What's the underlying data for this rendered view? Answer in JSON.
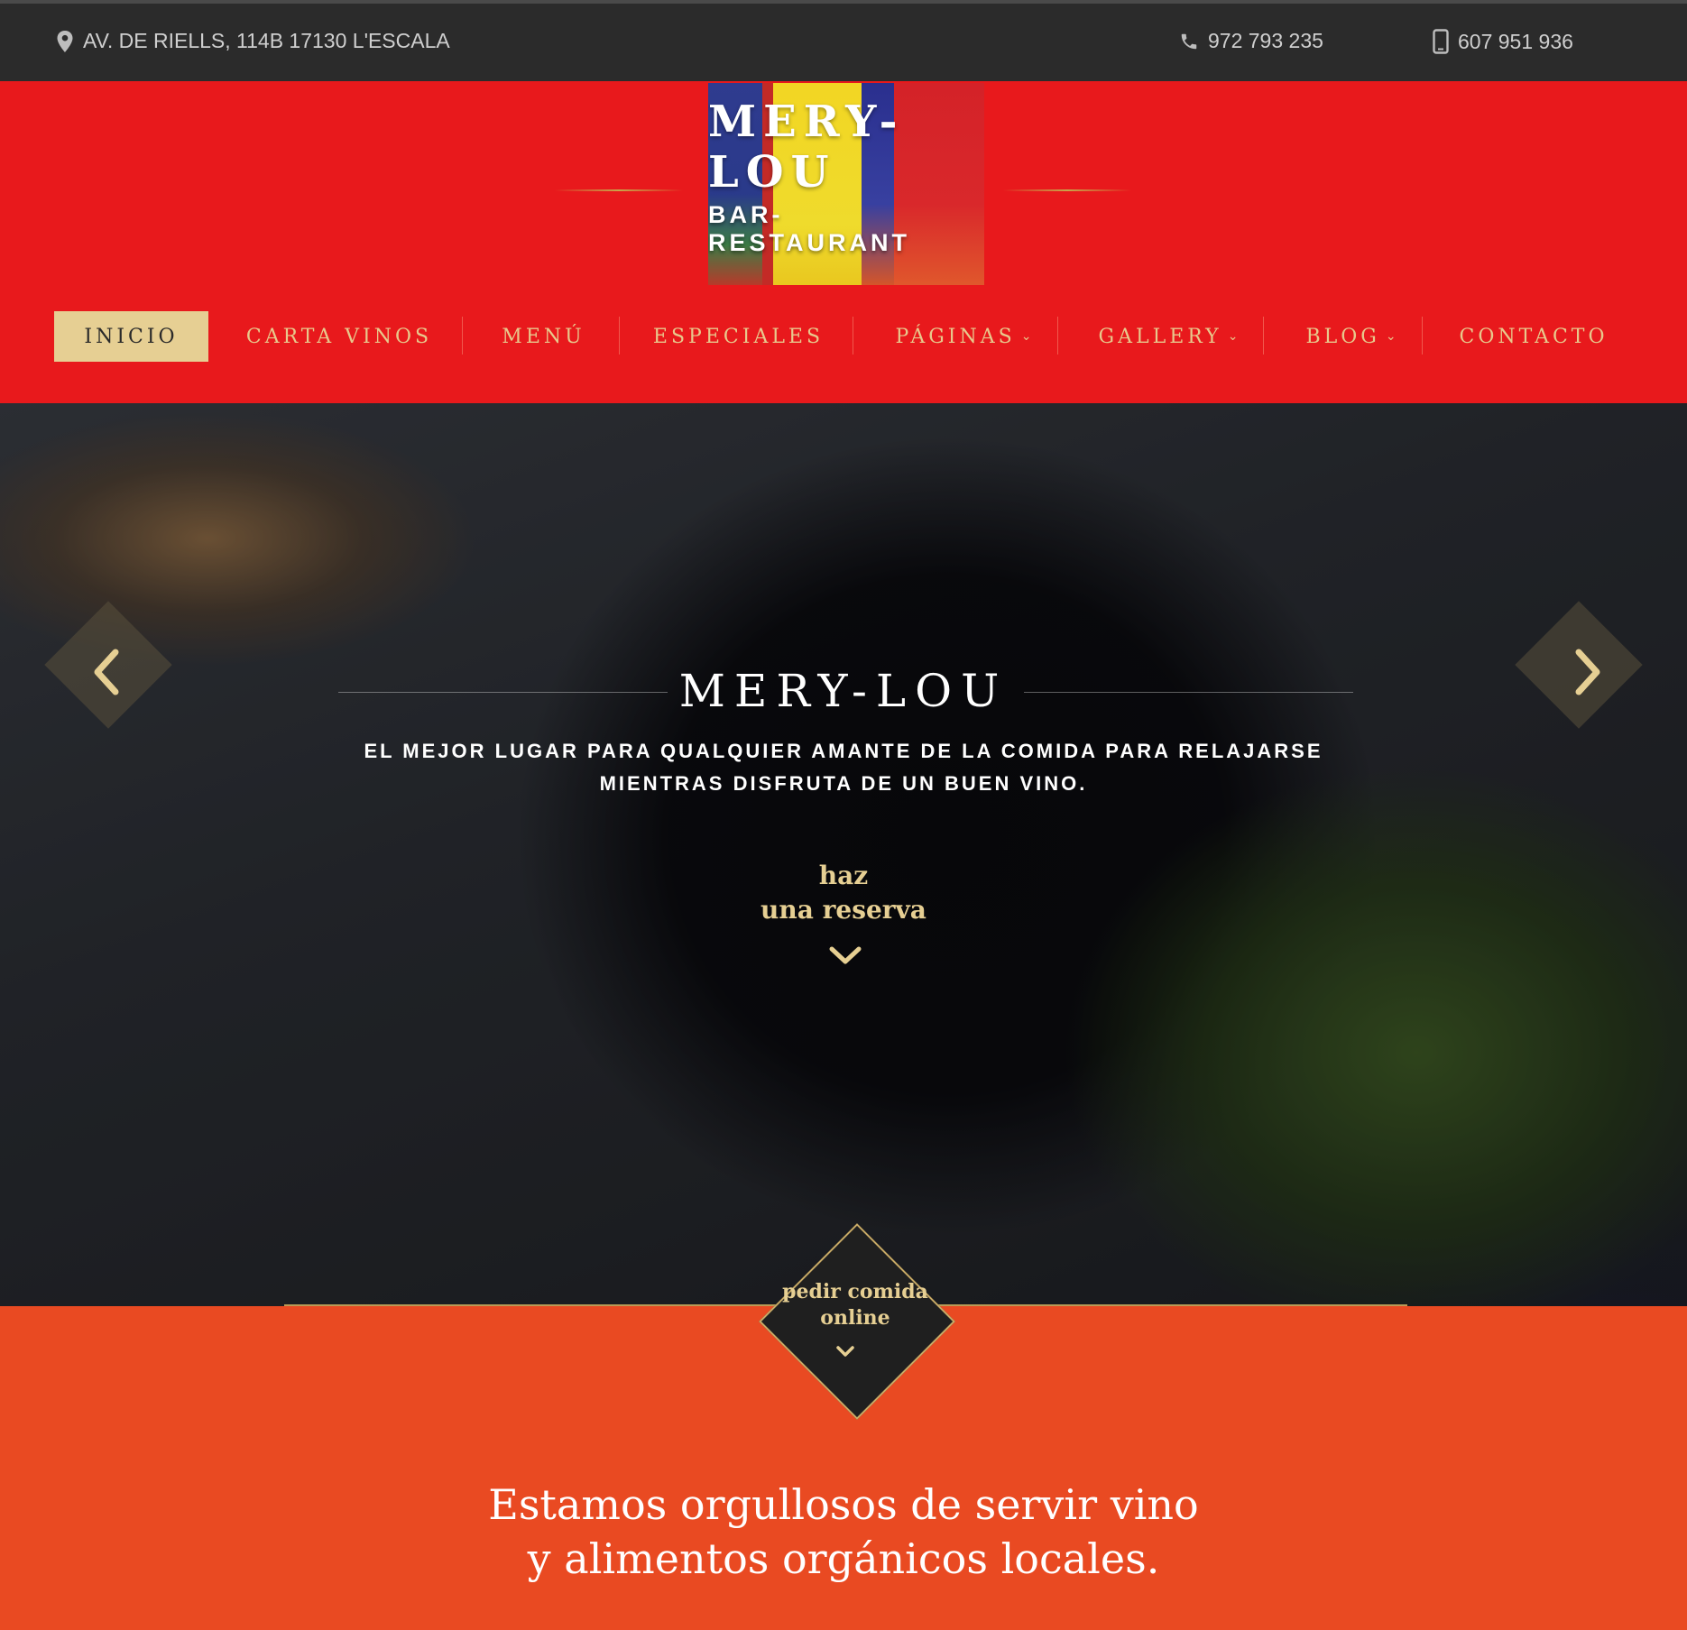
{
  "topbar": {
    "address": "AV. DE RIELLS, 114B 17130 L'ESCALA",
    "phone": "972 793 235",
    "mobile": "607 951 936"
  },
  "logo": {
    "name": "MERY-LOU",
    "subtitle": "BAR-RESTAURANT"
  },
  "nav": {
    "items": [
      {
        "label": "INICIO",
        "active": true
      },
      {
        "label": "CARTA VINOS"
      },
      {
        "label": "MENÚ"
      },
      {
        "label": "ESPECIALES"
      },
      {
        "label": "PÁGINAS",
        "dropdown": true
      },
      {
        "label": "GALLERY",
        "dropdown": true
      },
      {
        "label": "BLOG",
        "dropdown": true
      },
      {
        "label": "CONTACTO"
      }
    ]
  },
  "hero": {
    "title": "MERY-LOU",
    "subtitle_line1": "EL MEJOR LUGAR PARA QUALQUIER AMANTE DE LA COMIDA PARA RELAJARSE",
    "subtitle_line2": "MIENTRAS DISFRUTA DE UN BUEN VINO.",
    "reserve_line1": "haz",
    "reserve_line2": "una reserva"
  },
  "order": {
    "line1": "pedir comida",
    "line2": "online"
  },
  "tagline": {
    "line1": "Estamos orgullosos de servir vino",
    "line2": "y alimentos orgánicos locales."
  },
  "colors": {
    "topbar": "#2b2b2b",
    "header": "#e8191c",
    "accent_gold": "#e6cf93",
    "section_orange": "#e94a22"
  },
  "icons": {
    "address": "map-pin-icon",
    "phone": "phone-icon",
    "mobile": "mobile-phone-icon",
    "prev": "chevron-left-icon",
    "next": "chevron-right-icon",
    "down": "chevron-down-icon"
  }
}
